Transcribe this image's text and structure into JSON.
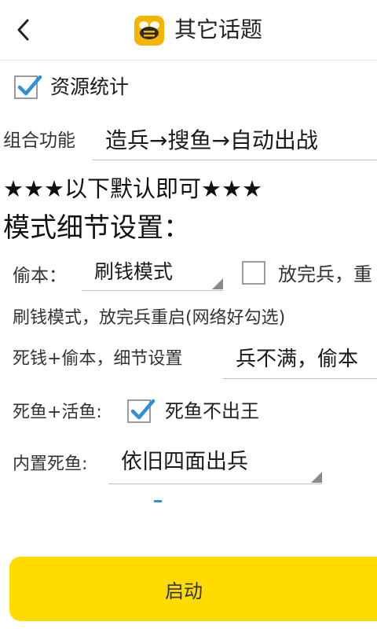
{
  "header": {
    "title": "其它话题",
    "back_icon": "chevron-left-icon",
    "logo_icon": "bee-logo-icon",
    "logo_color": "#f5b400"
  },
  "resource_stats": {
    "label": "资源统计",
    "checked": true
  },
  "combo": {
    "label": "组合功能",
    "value": "造兵→搜鱼→自动出战"
  },
  "notice": "★★★以下默认即可★★★",
  "section_title": "模式细节设置：",
  "steal": {
    "label": "偷本：",
    "mode_value": "刷钱模式",
    "reset_checkbox_label": "放完兵，重",
    "reset_checked": false
  },
  "hint_text": "刷钱模式，放完兵重启(网络好勾选)",
  "dead_steal": {
    "label": "死钱+偷本，细节设置",
    "value": "兵不满，偷本"
  },
  "dead_live": {
    "label": "死鱼+活鱼:",
    "checkbox_label": "死鱼不出王",
    "checked": true
  },
  "builtin_dead": {
    "label": "内置死鱼:",
    "value": "依旧四面出兵"
  },
  "start_button": {
    "label": "启动",
    "color": "#ffdb00"
  },
  "colors": {
    "check_blue": "#2f8fd8",
    "triangle_gray": "#8a8a8a"
  }
}
